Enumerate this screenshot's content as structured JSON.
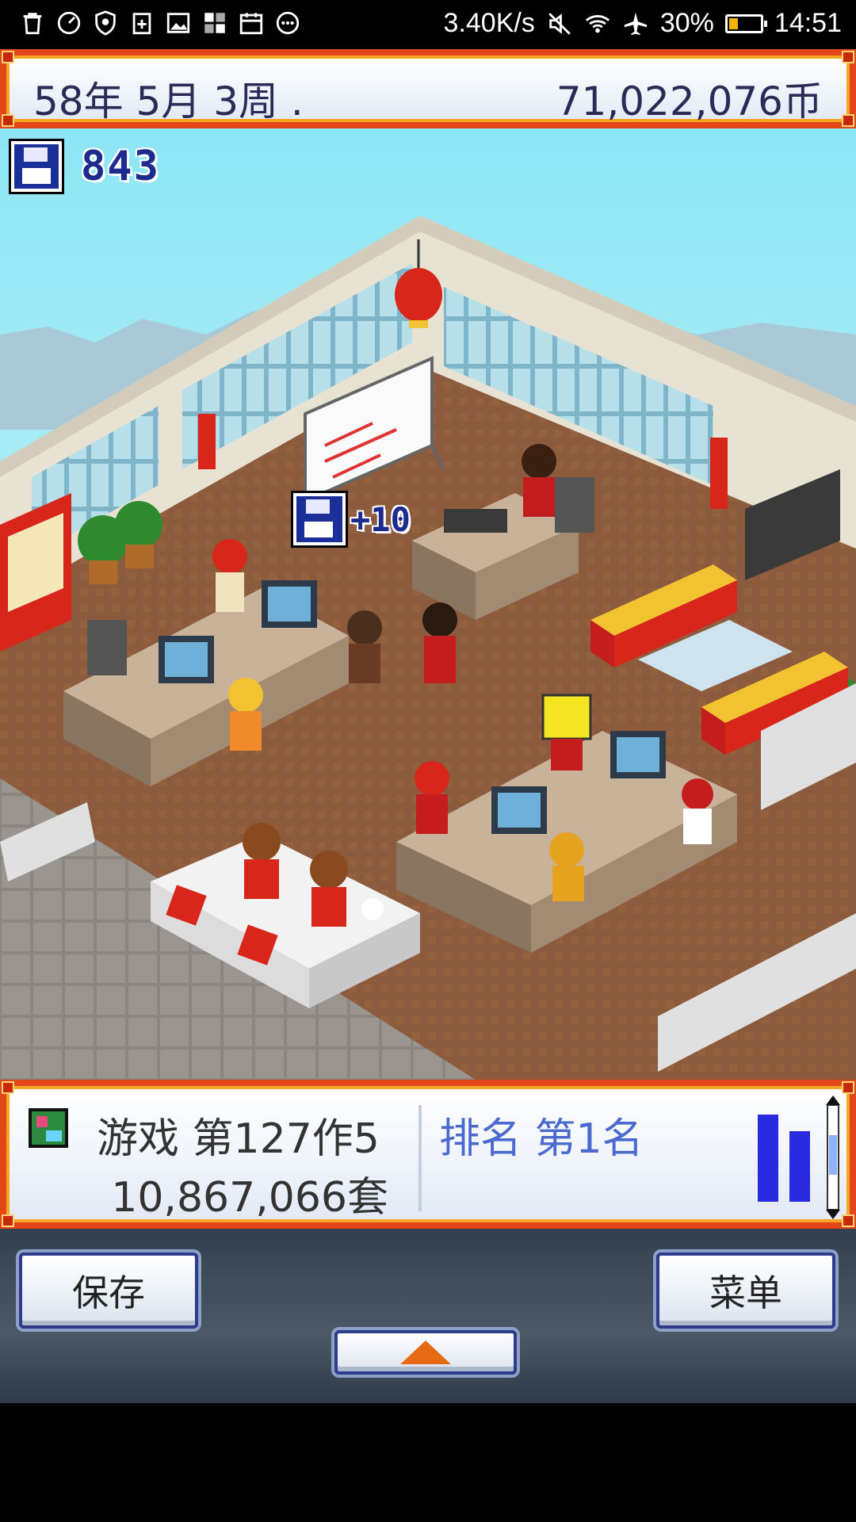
{
  "status_bar": {
    "net_speed": "3.40K/s",
    "battery_text": "30%",
    "battery_level": 0.3,
    "time": "14:51",
    "left_icons": [
      "trash-icon",
      "speedometer-icon",
      "shield-icon",
      "clipboard-plus-icon",
      "image-icon",
      "widgets-icon",
      "calendar-icon",
      "more-dots-icon"
    ],
    "right_icons": [
      "mute-icon",
      "wifi-icon",
      "airplane-icon",
      "battery-icon"
    ]
  },
  "top_bar": {
    "date": "58年 5月 3周 .",
    "money": "71,022,076币"
  },
  "research": {
    "points": "843",
    "gain_popup": "+10"
  },
  "game_panel": {
    "title": "游戏 第127作5",
    "sales": "10,867,066套",
    "rank": "排名 第1名",
    "rank_bars": [
      0.93,
      0.75
    ],
    "bar_color": "#2a2ae0"
  },
  "controls": {
    "save_label": "保存",
    "menu_label": "菜单",
    "expand_icon": "arrow-up-icon",
    "arrow_color": "#e66a14"
  },
  "colors": {
    "frame_red": "#e34717",
    "frame_gold": "#f5a623",
    "panel_text": "#2b2b58",
    "rank_text": "#4a6ad0"
  }
}
